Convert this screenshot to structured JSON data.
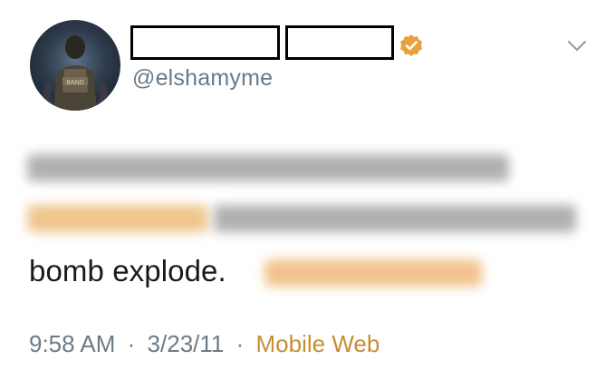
{
  "user": {
    "handle": "@elshamyme",
    "avatar_text": "BAND"
  },
  "icons": {
    "verified": "verified-badge-icon",
    "menu": "chevron-down-icon"
  },
  "colors": {
    "verified_badge": "#e9a23b",
    "source_link": "#c78e34",
    "meta_text": "#6b7b87",
    "handle_text": "#697a86"
  },
  "tweet": {
    "visible_text": "bomb explode."
  },
  "meta": {
    "time": "9:58 AM",
    "separator": "·",
    "date": "3/23/11",
    "source": "Mobile Web"
  }
}
